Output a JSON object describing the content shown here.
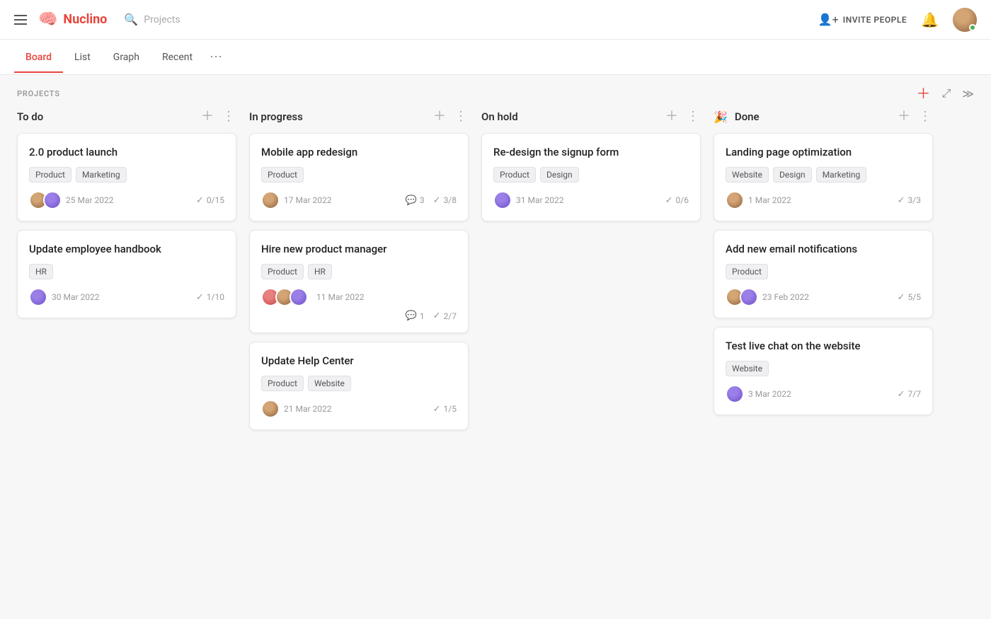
{
  "header": {
    "logo_text": "Nuclino",
    "search_placeholder": "Projects",
    "invite_label": "INVITE PEOPLE",
    "tabs": [
      {
        "id": "board",
        "label": "Board",
        "active": true
      },
      {
        "id": "list",
        "label": "List",
        "active": false
      },
      {
        "id": "graph",
        "label": "Graph",
        "active": false
      },
      {
        "id": "recent",
        "label": "Recent",
        "active": false
      }
    ]
  },
  "board": {
    "section_title": "PROJECTS",
    "columns": [
      {
        "id": "todo",
        "title": "To do",
        "icon": "",
        "cards": [
          {
            "id": "c1",
            "title": "2.0 product launch",
            "tags": [
              "Product",
              "Marketing"
            ],
            "date": "25 Mar 2022",
            "avatars": [
              "av1",
              "av2"
            ],
            "checks": "0/15",
            "comments": null
          },
          {
            "id": "c2",
            "title": "Update employee handbook",
            "tags": [
              "HR"
            ],
            "date": "30 Mar 2022",
            "avatars": [
              "av2"
            ],
            "checks": "1/10",
            "comments": null
          }
        ]
      },
      {
        "id": "inprogress",
        "title": "In progress",
        "icon": "",
        "cards": [
          {
            "id": "c3",
            "title": "Mobile app redesign",
            "tags": [
              "Product"
            ],
            "date": "17 Mar 2022",
            "avatars": [
              "av1"
            ],
            "checks": "3/8",
            "comments": "3"
          },
          {
            "id": "c4",
            "title": "Hire new product manager",
            "tags": [
              "Product",
              "HR"
            ],
            "date": "11 Mar 2022",
            "avatars": [
              "av3",
              "av1",
              "av2"
            ],
            "checks": "2/7",
            "comments": "1"
          },
          {
            "id": "c5",
            "title": "Update Help Center",
            "tags": [
              "Product",
              "Website"
            ],
            "date": "21 Mar 2022",
            "avatars": [
              "av1"
            ],
            "checks": "1/5",
            "comments": null
          }
        ]
      },
      {
        "id": "onhold",
        "title": "On hold",
        "icon": "",
        "cards": [
          {
            "id": "c6",
            "title": "Re-design the signup form",
            "tags": [
              "Product",
              "Design"
            ],
            "date": "31 Mar 2022",
            "avatars": [
              "av2"
            ],
            "checks": "0/6",
            "comments": null
          }
        ]
      },
      {
        "id": "done",
        "title": "Done",
        "icon": "🎉",
        "cards": [
          {
            "id": "c7",
            "title": "Landing page optimization",
            "tags": [
              "Website",
              "Design",
              "Marketing"
            ],
            "date": "1 Mar 2022",
            "avatars": [
              "av1"
            ],
            "checks": "3/3",
            "comments": null
          },
          {
            "id": "c8",
            "title": "Add new email notifications",
            "tags": [
              "Product"
            ],
            "date": "23 Feb 2022",
            "avatars": [
              "av1",
              "av2"
            ],
            "checks": "5/5",
            "comments": null
          },
          {
            "id": "c9",
            "title": "Test live chat on the website",
            "tags": [
              "Website"
            ],
            "date": "3 Mar 2022",
            "avatars": [
              "av2"
            ],
            "checks": "7/7",
            "comments": null
          }
        ]
      }
    ]
  }
}
